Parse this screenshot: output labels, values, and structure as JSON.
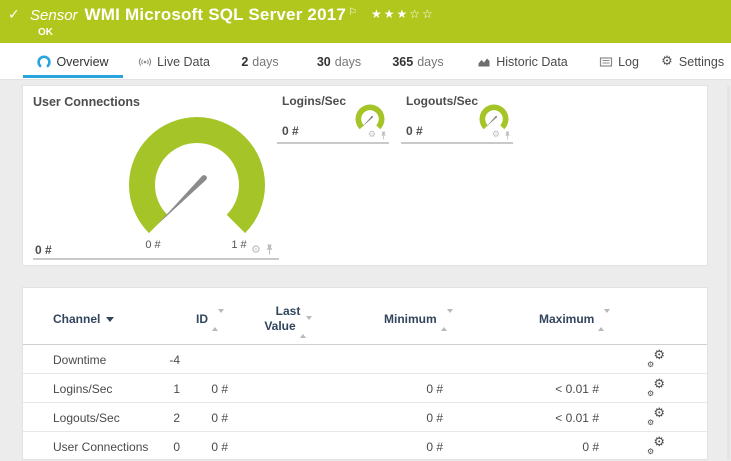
{
  "colors": {
    "brand_green": "#b2c71d",
    "gauge_green": "#a5c428",
    "accent_blue": "#2aa4dc",
    "header_navy": "#32455c"
  },
  "header": {
    "checkmark": "✓",
    "type_label": "Sensor",
    "title": "WMI Microsoft SQL Server 2017",
    "flag": "⚐",
    "status": "OK",
    "rating_filled": "★★★",
    "rating_empty": "☆☆"
  },
  "tabs": {
    "overview": "Overview",
    "live_data": "Live Data",
    "days2_num": "2",
    "days2_unit": "days",
    "days30_num": "30",
    "days30_unit": "days",
    "days365_num": "365",
    "days365_unit": "days",
    "historic": "Historic Data",
    "log": "Log",
    "settings": "Settings"
  },
  "gauges": {
    "user_connections": {
      "title": "User Connections",
      "value": "0 #",
      "scale_min": "0 #",
      "scale_max": "1 #"
    },
    "logins_sec": {
      "title": "Logins/Sec",
      "value": "0 #"
    },
    "logouts_sec": {
      "title": "Logouts/Sec",
      "value": "0 #"
    }
  },
  "table": {
    "headers": {
      "channel": "Channel",
      "id": "ID",
      "last_1": "Last",
      "last_2": "Value",
      "minimum": "Minimum",
      "maximum": "Maximum"
    },
    "rows": [
      {
        "channel": "Downtime",
        "id": "-4",
        "last": "",
        "min": "",
        "max": ""
      },
      {
        "channel": "Logins/Sec",
        "id": "1",
        "last": "0 #",
        "min": "0 #",
        "max": "< 0.01 #"
      },
      {
        "channel": "Logouts/Sec",
        "id": "2",
        "last": "0 #",
        "min": "0 #",
        "max": "< 0.01 #"
      },
      {
        "channel": "User Connections",
        "id": "0",
        "last": "0 #",
        "min": "0 #",
        "max": "0 #"
      }
    ]
  }
}
